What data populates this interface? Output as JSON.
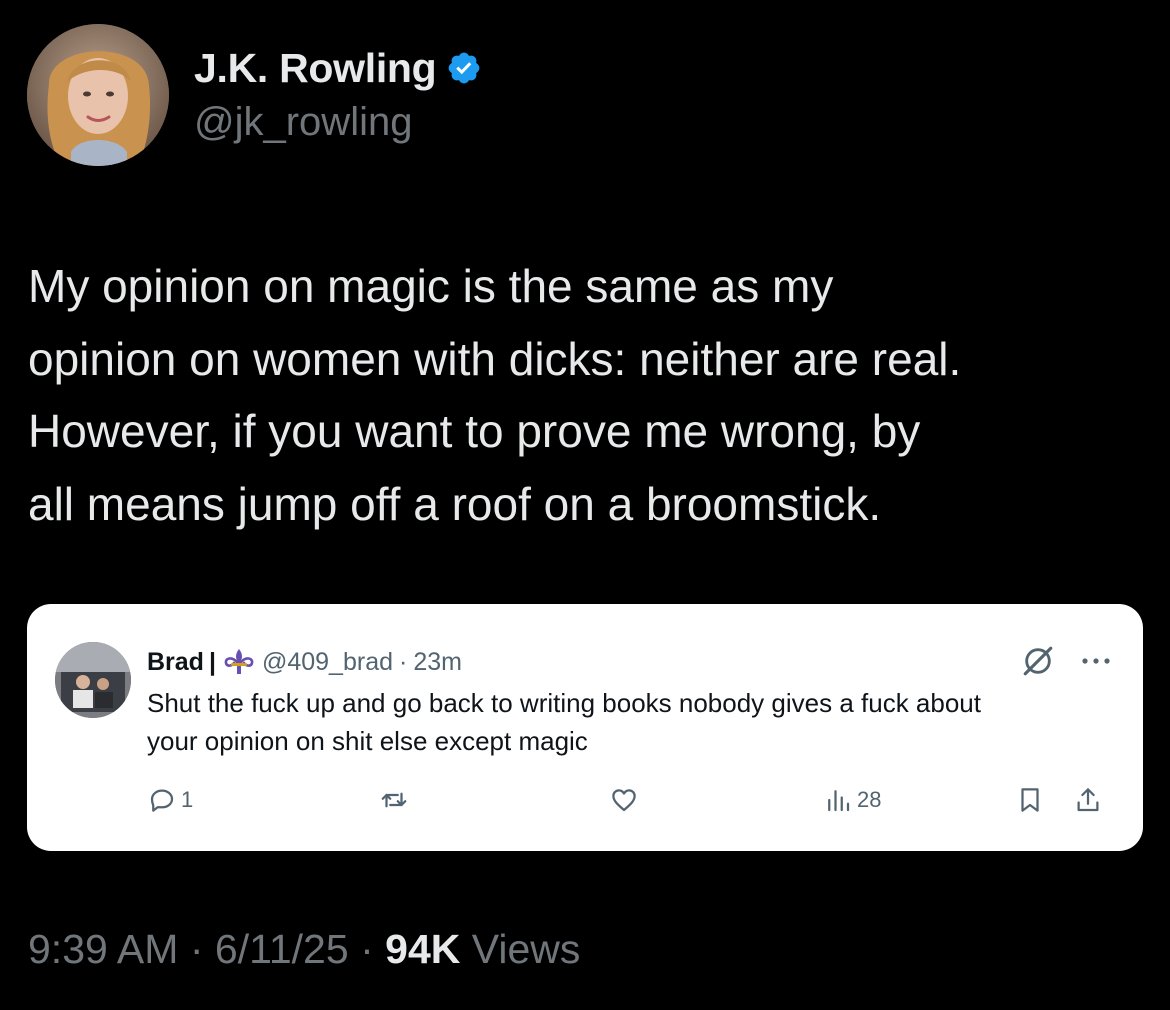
{
  "author": {
    "display_name": "J.K. Rowling",
    "handle": "@jk_rowling",
    "verified_icon": "verified-badge-icon",
    "accent_color": "#1d9bf0"
  },
  "tweet": {
    "lines": [
      "My opinion on magic is the same as my",
      "opinion on women with dicks: neither are real.",
      "However, if you want to prove me wrong, by",
      "all means jump off a roof on a broomstick."
    ]
  },
  "quoted_post": {
    "display_name": "Brad",
    "separator": "|",
    "name_icon": "fleur-de-lis-icon",
    "handle": "@409_brad",
    "dot": "·",
    "time": "23m",
    "lines": [
      "Shut the fuck up and go back to writing books nobody gives a fuck about",
      "your opinion on shit else except magic"
    ],
    "actions": {
      "reply_count": "1",
      "views_count": "28"
    }
  },
  "footer": {
    "time": "9:39 AM",
    "dot1": "·",
    "date": "6/11/25",
    "dot2": "·",
    "views_count": "94K",
    "views_label": "Views"
  }
}
